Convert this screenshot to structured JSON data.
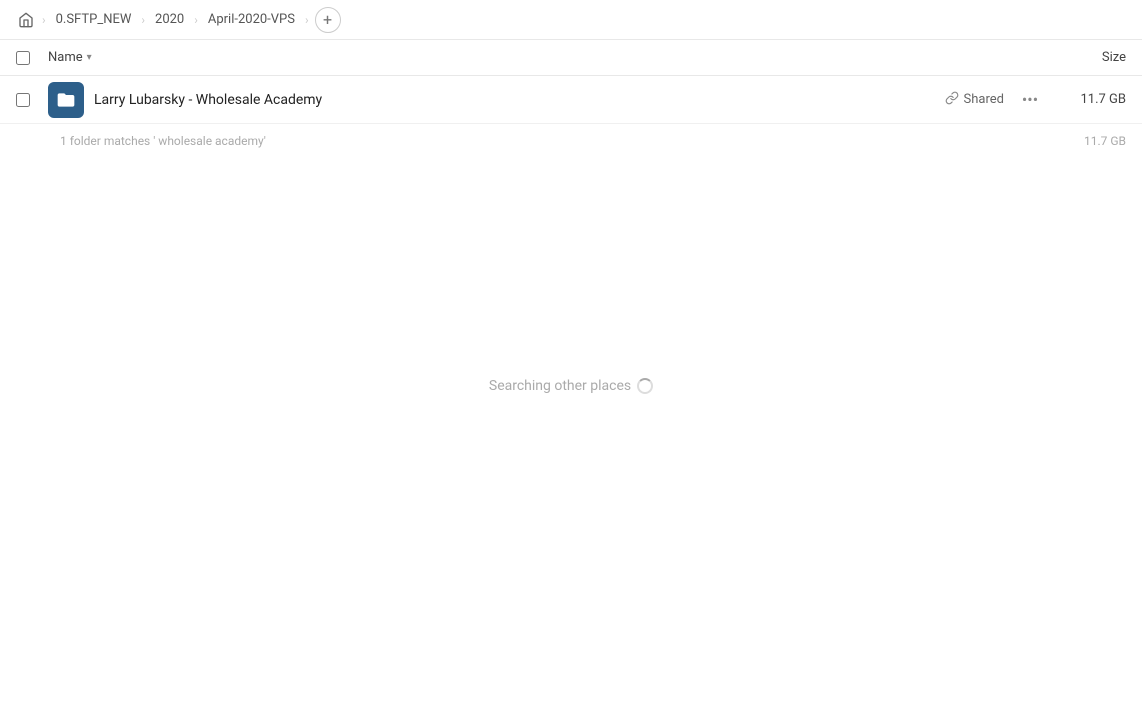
{
  "breadcrumb": {
    "home_label": "Home",
    "items": [
      {
        "label": "0.SFTP_NEW"
      },
      {
        "label": "2020"
      },
      {
        "label": "April-2020-VPS"
      }
    ],
    "add_label": "+"
  },
  "column_header": {
    "name_label": "Name",
    "name_arrow": "▾",
    "size_label": "Size"
  },
  "file_row": {
    "name": "Larry Lubarsky - Wholesale Academy",
    "shared_label": "Shared",
    "more_label": "•••",
    "size": "11.7 GB"
  },
  "match_info": {
    "text": "1 folder matches ' wholesale academy'",
    "size": "11.7 GB"
  },
  "searching": {
    "text": "Searching other places"
  }
}
